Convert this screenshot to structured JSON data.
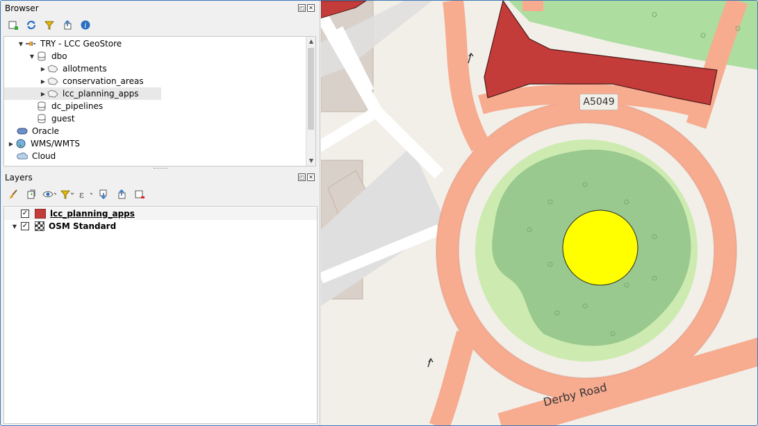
{
  "browser": {
    "title": "Browser",
    "items": [
      {
        "label": "TRY - LCC GeoStore",
        "arrow": "▼"
      },
      {
        "label": "dbo",
        "arrow": "▼"
      },
      {
        "label": "allotments",
        "arrow": "▶"
      },
      {
        "label": "conservation_areas",
        "arrow": "▶"
      },
      {
        "label": "lcc_planning_apps",
        "arrow": "▶"
      },
      {
        "label": "dc_pipelines",
        "arrow": ""
      },
      {
        "label": "guest",
        "arrow": ""
      },
      {
        "label": "Oracle",
        "arrow": ""
      },
      {
        "label": "WMS/WMTS",
        "arrow": "▶"
      },
      {
        "label": "Cloud",
        "arrow": ""
      }
    ]
  },
  "layers": {
    "title": "Layers",
    "items": [
      {
        "label": "lcc_planning_apps",
        "checked": "✓",
        "arrow": ""
      },
      {
        "label": "OSM Standard",
        "checked": "✓",
        "arrow": "▼"
      }
    ]
  },
  "map": {
    "road_label_1": "A5049",
    "road_label_2": "Derby Road"
  },
  "colors": {
    "accent": "#3b78b5",
    "layer_fill": "#c43c39",
    "point_fill": "#ffff00",
    "road": "#f7ab8f",
    "park": "#addd9f",
    "forest": "#99c98e"
  }
}
